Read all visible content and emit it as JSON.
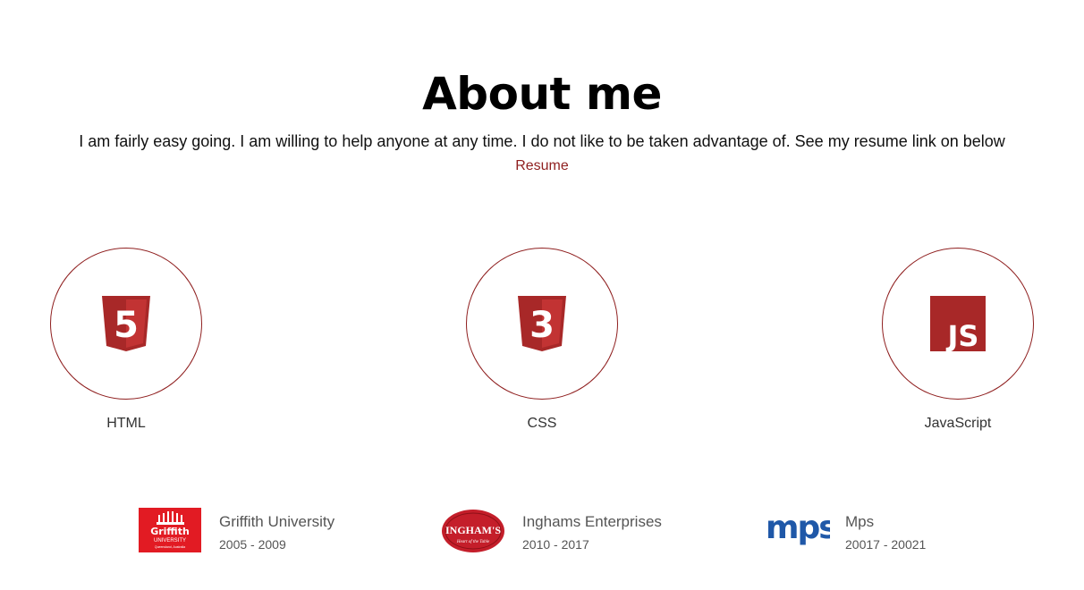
{
  "about": {
    "title": "About me",
    "intro": "I am fairly easy going. I am willing to help anyone at any time. I do not like to be taken advantage of. See my resume link on below",
    "resume_link": "Resume"
  },
  "skills": [
    {
      "label": "HTML",
      "icon": "html5-icon",
      "badge": "5"
    },
    {
      "label": "CSS",
      "icon": "css3-icon",
      "badge": "3"
    },
    {
      "label": "JavaScript",
      "icon": "javascript-icon",
      "badge": "JS"
    }
  ],
  "experience": [
    {
      "name": "Griffith University",
      "years": "2005 - 2009",
      "logo": {
        "line1": "Griffith",
        "line2": "UNIVERSITY",
        "line3": "Queensland, Australia"
      }
    },
    {
      "name": "Inghams Enterprises",
      "years": "2010 - 2017",
      "logo": {
        "line1": "INGHAM'S",
        "line2": "Heart of the Table"
      }
    },
    {
      "name": "Mps",
      "years": "20017 - 20021",
      "logo": {
        "line1": "mps"
      }
    }
  ],
  "colors": {
    "accent": "#8f1f1f",
    "badge_red": "#a82828",
    "griffith_red": "#e21b23",
    "inghams_red": "#c41e2a",
    "mps_blue": "#1f58a8"
  }
}
